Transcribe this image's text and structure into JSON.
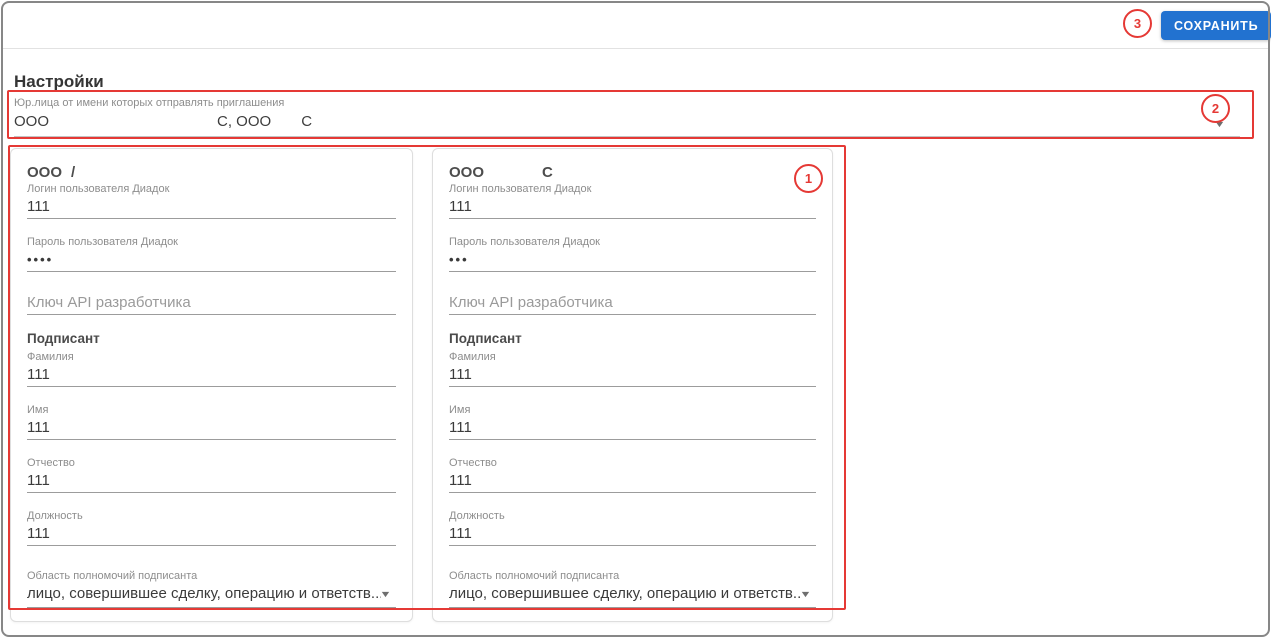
{
  "colors": {
    "primary_blue": "#2272d0",
    "annotation_red": "#e53935"
  },
  "toolbar": {
    "save_label": "СОХРАНИТЬ"
  },
  "page": {
    "title": "Настройки"
  },
  "org_select": {
    "label": "Юр.лица от имени которых отправлять приглашения",
    "value_parts": [
      "ООО",
      "С, ООО",
      "С"
    ],
    "dropdown_icon": "▼"
  },
  "cards": [
    {
      "title_parts": [
        "ООО",
        "/"
      ],
      "login": {
        "label": "Логин пользователя Диадок",
        "value": "111"
      },
      "password": {
        "label": "Пароль пользователя Диадок",
        "value": "••••"
      },
      "api_key": {
        "placeholder": "Ключ API разработчика",
        "value": ""
      },
      "signer_heading": "Подписант",
      "surname": {
        "label": "Фамилия",
        "value": "111"
      },
      "first_name": {
        "label": "Имя",
        "value": "111"
      },
      "patronymic": {
        "label": "Отчество",
        "value": "111"
      },
      "position": {
        "label": "Должность",
        "value": "111"
      },
      "authority": {
        "label": "Область полномочий подписанта",
        "value": "лицо, совершившее сделку, операцию и ответств...",
        "dropdown_icon": "▼"
      }
    },
    {
      "title_parts": [
        "ООО",
        "С"
      ],
      "login": {
        "label": "Логин пользователя Диадок",
        "value": "111"
      },
      "password": {
        "label": "Пароль пользователя Диадок",
        "value": "•••"
      },
      "api_key": {
        "placeholder": "Ключ API разработчика",
        "value": ""
      },
      "signer_heading": "Подписант",
      "surname": {
        "label": "Фамилия",
        "value": "111"
      },
      "first_name": {
        "label": "Имя",
        "value": "111"
      },
      "patronymic": {
        "label": "Отчество",
        "value": "111"
      },
      "position": {
        "label": "Должность",
        "value": "111"
      },
      "authority": {
        "label": "Область полномочий подписанта",
        "value": "лицо, совершившее сделку, операцию и ответств...",
        "dropdown_icon": "▼"
      }
    }
  ],
  "annotations": [
    {
      "number": "1"
    },
    {
      "number": "2"
    },
    {
      "number": "3"
    }
  ]
}
